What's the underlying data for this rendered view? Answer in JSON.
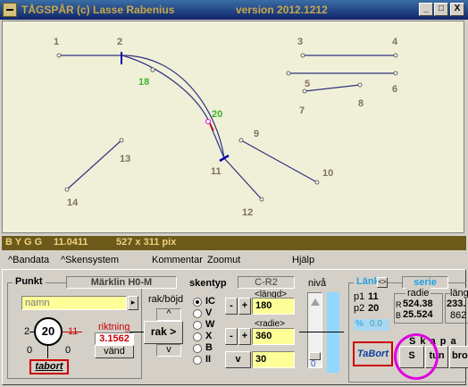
{
  "window": {
    "app_name": "TÅGSPÅR",
    "copyright": "(c) Lasse Rabenius",
    "version": "version 2012.1212",
    "min_glyph": "_",
    "max_glyph": "□",
    "close_glyph": "X"
  },
  "canvas": {
    "labels": {
      "n1": "1",
      "n2": "2",
      "n3": "3",
      "n4": "4",
      "n5": "5",
      "n6": "6",
      "n7": "7",
      "n8": "8",
      "n9": "9",
      "n10": "10",
      "n11": "11",
      "n12": "12",
      "n13": "13",
      "n14": "14",
      "n18": "18",
      "n20": "20"
    }
  },
  "status": {
    "mode": "B Y G G",
    "build": "11.0411",
    "size": "527 x 311 pix"
  },
  "menu": {
    "bandata": "^Bandata",
    "skensystem": "^Skensystem",
    "kommentar": "Kommentar",
    "zoomut": "Zoomut",
    "hjalp": "Hjälp"
  },
  "punkt": {
    "title": "Punkt",
    "system": "Märklin H0-M",
    "name_placeholder": "namn",
    "node": "20",
    "left_num": "2",
    "right_num": "11",
    "bottom_left": "0",
    "bottom_right": "0",
    "riktning_label": "riktning",
    "riktning_value": "3.1562",
    "vand": "vänd",
    "tabort": "tabort"
  },
  "rakbojd": {
    "title": "rak/böjd",
    "button": "rak >",
    "up": "^",
    "down": "v"
  },
  "skentyp": {
    "title": "skentyp",
    "code": "C-R2",
    "options": [
      "IC",
      "V",
      "W",
      "X",
      "B",
      "II"
    ],
    "selected": "IC",
    "langd_label": "<längd>",
    "langd_value": "180",
    "radie_label": "<radie>",
    "radie_value": "360",
    "v_label": "v",
    "v_value": "30",
    "minus": "-",
    "plus": "+"
  },
  "niva": {
    "title": "nivå",
    "value": "0"
  },
  "lank": {
    "title": "Länk",
    "toggle": "<>",
    "serie": "serie",
    "p1_label": "p1",
    "p1_value": "11",
    "p2_label": "p2",
    "p2_value": "20",
    "radie_label": "radie",
    "r_label": "R",
    "r_value": "524.38",
    "b_label": "B",
    "b_value": "25.524",
    "langd_label": "läng",
    "langd_v1": "233.",
    "langd_v2": "862",
    "pct": "%",
    "pct_value": "0.0",
    "tabort": "TaBort",
    "skapa": "S k a p a",
    "btn_s": "S",
    "btn_tun": "tun",
    "btn_bro": "bro"
  },
  "colors": {
    "accent_red": "#cc0000",
    "node_green": "#40b030",
    "track_blue": "#303080",
    "highlight": "#e000e0"
  }
}
